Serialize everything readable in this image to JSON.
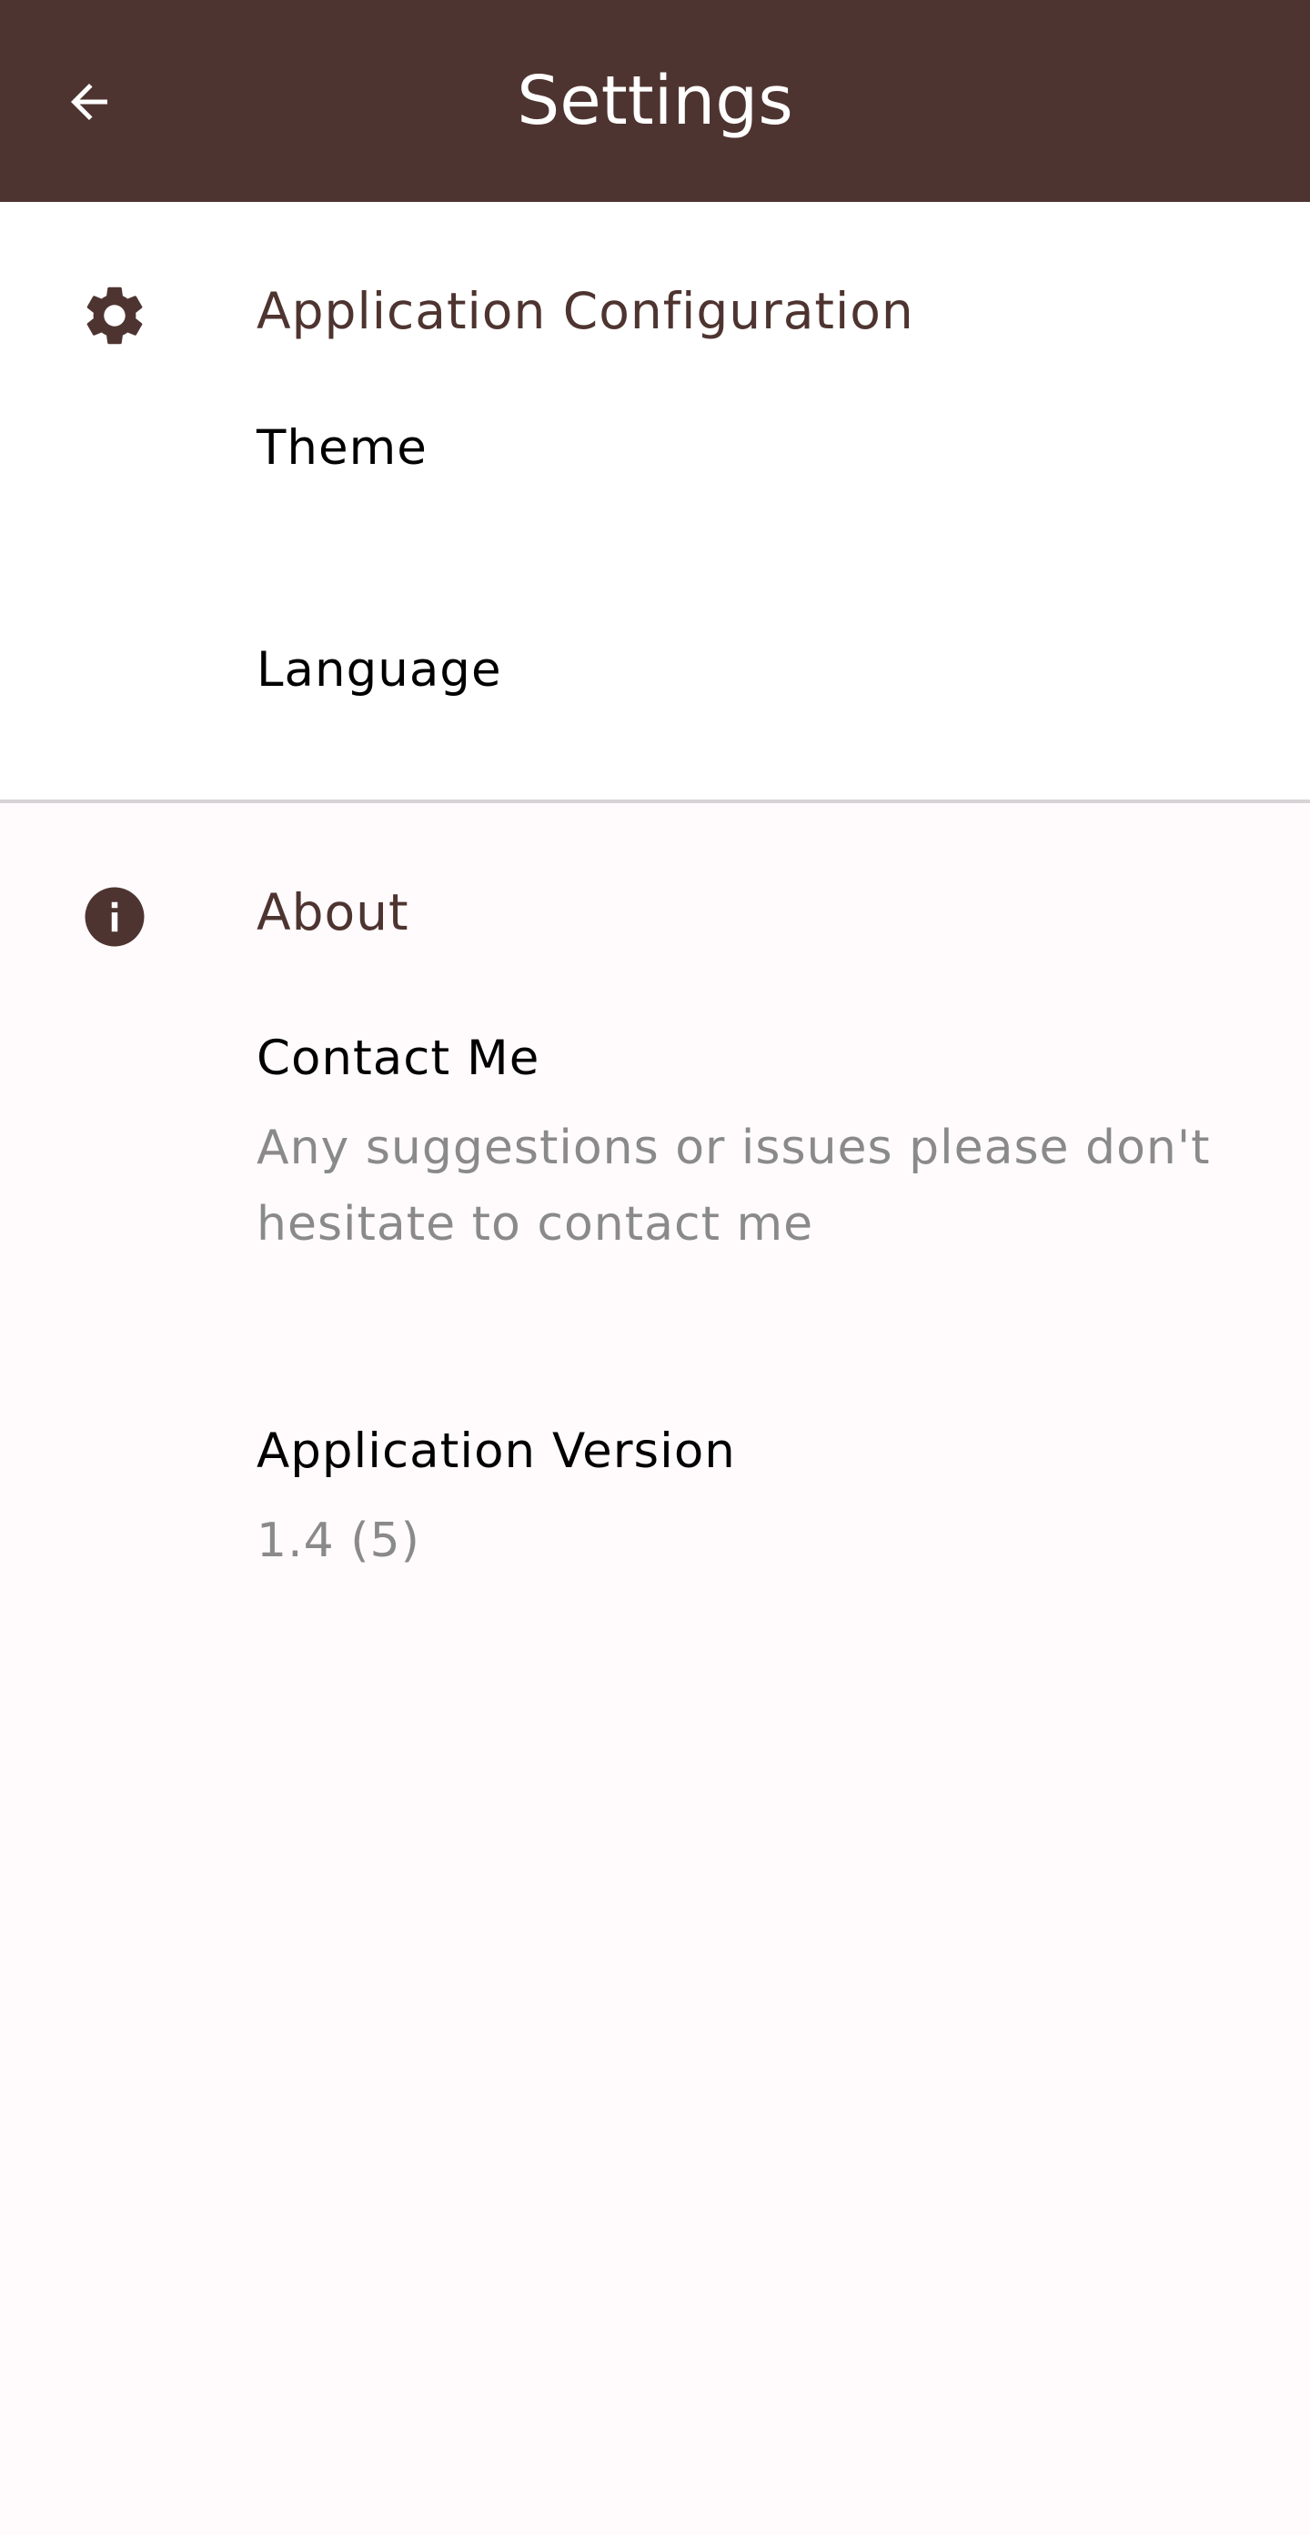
{
  "appbar": {
    "title": "Settings",
    "back_icon": "arrow-back-icon",
    "background": "#4e3430"
  },
  "config": {
    "header": "Application Configuration",
    "icon": "gear-icon",
    "items": [
      {
        "title": "Theme"
      },
      {
        "title": "Language"
      }
    ]
  },
  "about": {
    "header": "About",
    "icon": "info-icon",
    "items": [
      {
        "title": "Contact Me",
        "subtitle": "Any suggestions or issues please don't hesitate to contact me"
      },
      {
        "title": "Application Version",
        "subtitle": "1.4 (5)"
      }
    ]
  },
  "colors": {
    "accent": "#4e3430",
    "subtitle": "#8a8a8a",
    "divider": "#d6d4d6"
  }
}
